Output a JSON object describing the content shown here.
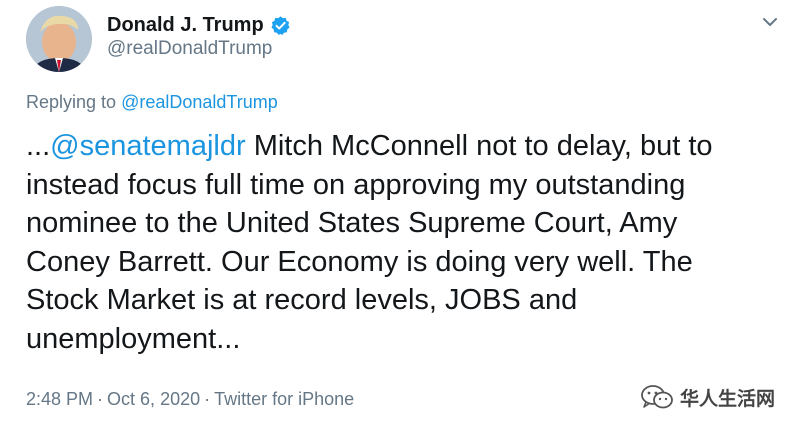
{
  "author": {
    "display_name": "Donald J. Trump",
    "handle": "@realDonaldTrump",
    "verified": true,
    "verified_color": "#1da1f2",
    "avatar_icon": "avatar-photo"
  },
  "menu_icon": "chevron-down-icon",
  "reply_context": {
    "prefix": "Replying to",
    "target": "@realDonaldTrump"
  },
  "tweet": {
    "lines": [
      {
        "leading": "...",
        "mention": "@senatemajldr",
        "rest": " Mitch McConnell not to delay, but to"
      },
      {
        "text": "instead focus full time on approving my outstanding"
      },
      {
        "text": "nominee to the United States Supreme Court, Amy"
      },
      {
        "text": "Coney Barrett. Our Economy is doing very well. The"
      },
      {
        "text": "Stock Market is at record levels, JOBS and"
      },
      {
        "text": "unemployment..."
      }
    ]
  },
  "meta": {
    "time": "2:48 PM",
    "separator": "·",
    "date": "Oct 6, 2020",
    "source": "Twitter for iPhone"
  },
  "watermark": {
    "text": "华人生活网",
    "icon": "wechat-icon"
  },
  "colors": {
    "link": "#1b95e0",
    "secondary_text": "#657786",
    "primary_text": "#14171a"
  }
}
